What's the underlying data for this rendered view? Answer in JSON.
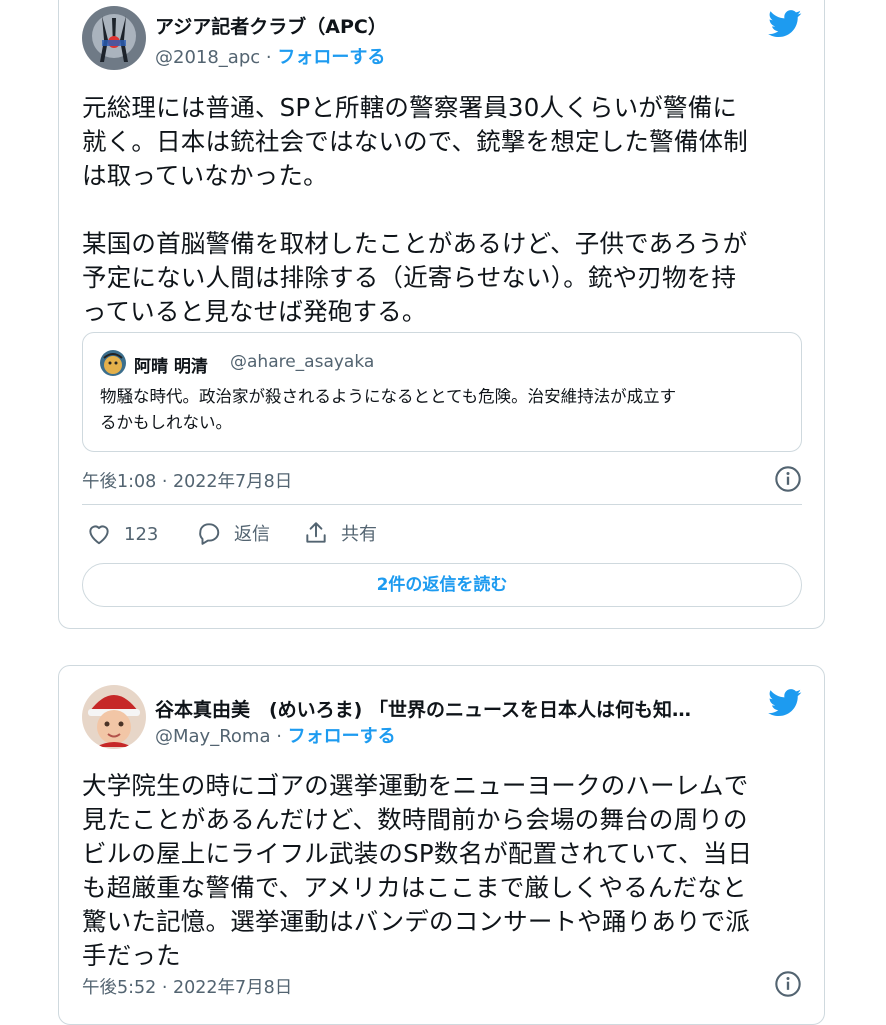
{
  "tweets": [
    {
      "author_name": "アジア記者クラブ（APC）",
      "handle": "@2018_apc",
      "separator": " · ",
      "follow_label": "フォローする",
      "body_lines": [
        "元総理には普通、SPと所轄の警察署員30人くらいが警備に",
        "就く。日本は銃社会ではないので、銃撃を想定した警備体制",
        "は取っていなかった。",
        "",
        "某国の首脳警備を取材したことがあるけど、子供であろうが",
        "予定にない人間は排除する（近寄らせない）。銃や刃物を持",
        "っていると見なせば発砲する。"
      ],
      "quote": {
        "author_name": "阿晴 明清",
        "handle": "@ahare_asayaka",
        "text_lines": [
          "物騒な時代。政治家が殺されるようになるととても危険。治安維持法が成立す",
          "るかもしれない。"
        ]
      },
      "timestamp": "午後1:08 · 2022年7月8日",
      "like_count": "123",
      "reply_label": "返信",
      "share_label": "共有",
      "read_replies_label": "2件の返信を読む"
    },
    {
      "author_name": "谷本真由美　(めいろま) 「世界のニュースを日本人は何も知…",
      "handle": "@May_Roma",
      "separator": " · ",
      "follow_label": "フォローする",
      "body_lines": [
        "大学院生の時にゴアの選挙運動をニューヨークのハーレムで",
        "見たことがあるんだけど、数時間前から会場の舞台の周りの",
        "ビルの屋上にライフル武装のSP数名が配置されていて、当日",
        "も超厳重な警備で、アメリカはここまで厳しくやるんだなと",
        "驚いた記憶。選挙運動はバンデのコンサートや踊りありで派",
        "手だった"
      ],
      "timestamp": "午後5:52 · 2022年7月8日"
    }
  ],
  "icons": {
    "brand": "twitter-bird-icon",
    "info": "info-icon",
    "like": "heart-icon",
    "reply": "speech-bubble-icon",
    "share": "share-icon"
  },
  "colors": {
    "accent": "#1d9bf0",
    "text": "#0f1419",
    "muted": "#536471",
    "border": "#cfd9de"
  }
}
